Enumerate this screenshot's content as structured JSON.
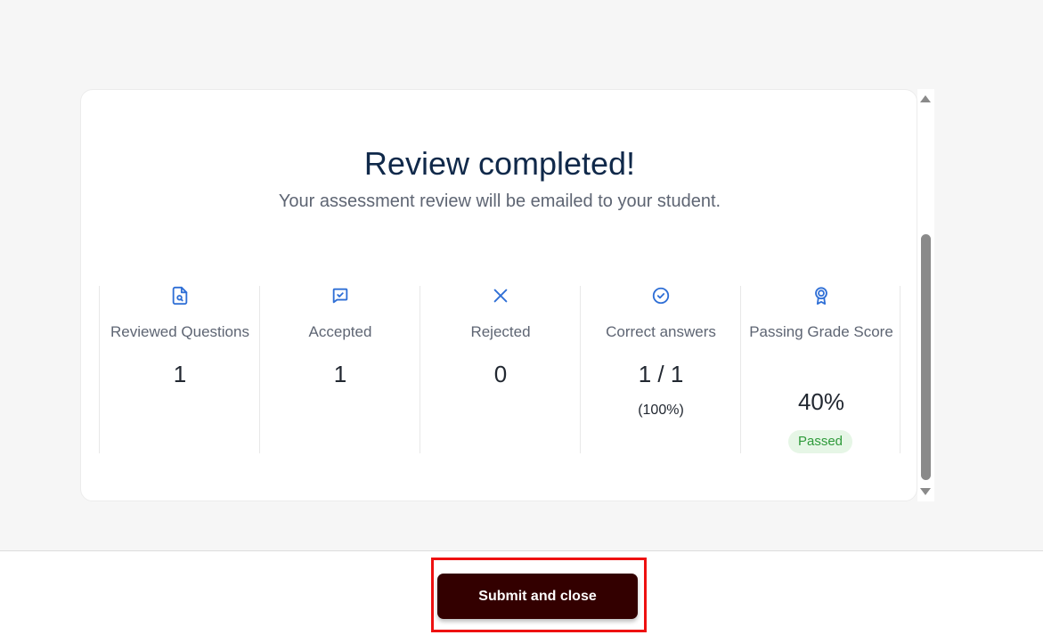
{
  "review": {
    "title": "Review completed!",
    "subtitle": "Your assessment review will be emailed to your student."
  },
  "stats": [
    {
      "icon": "file-search-icon",
      "label": "Reviewed Questions",
      "value": "1"
    },
    {
      "icon": "message-check-icon",
      "label": "Accepted",
      "value": "1"
    },
    {
      "icon": "x-icon",
      "label": "Rejected",
      "value": "0"
    },
    {
      "icon": "check-circle-icon",
      "label": "Correct answers",
      "value": "1 / 1",
      "sub": "(100%)"
    },
    {
      "icon": "award-icon",
      "label": "Passing Grade Score",
      "value": "40%",
      "badge": "Passed"
    }
  ],
  "footer": {
    "submit_label": "Submit and close"
  },
  "colors": {
    "accent_icon": "#2f6fd6",
    "title": "#10294a",
    "button_bg": "#330000",
    "badge_bg": "#e6f6e6",
    "badge_text": "#2e9a3a",
    "highlight": "#ee1111"
  }
}
